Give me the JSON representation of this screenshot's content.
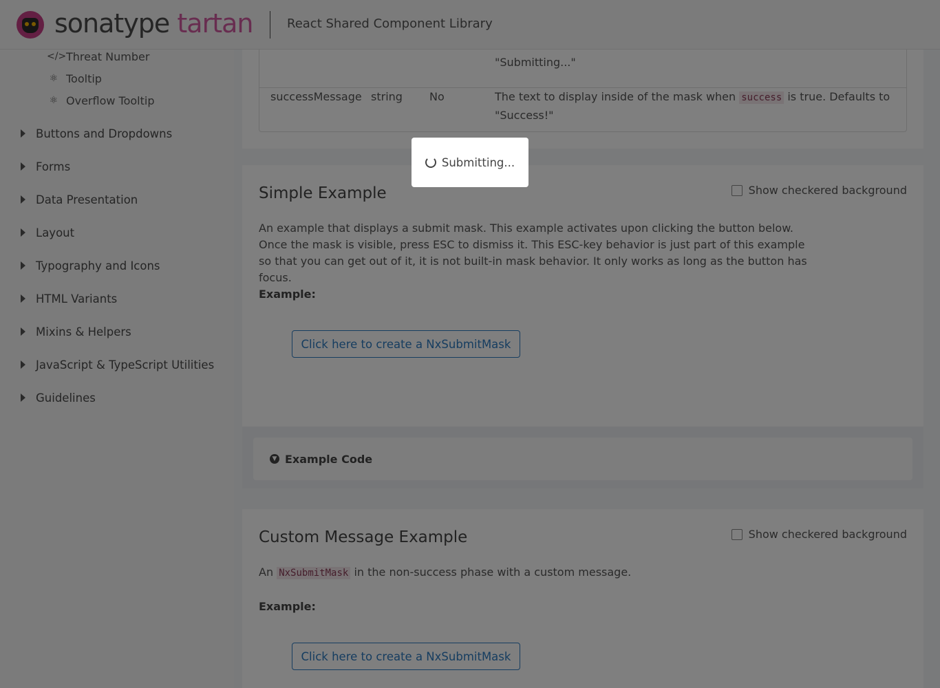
{
  "header": {
    "brand_primary": "sonatype",
    "brand_secondary": "tartan",
    "subtitle": "React Shared Component Library"
  },
  "sidebar": {
    "sub_items": [
      {
        "label": "Threat Number",
        "icon": "code-icon"
      },
      {
        "label": "Tooltip",
        "icon": "react-icon"
      },
      {
        "label": "Overflow Tooltip",
        "icon": "react-icon"
      }
    ],
    "sections": [
      "Buttons and Dropdowns",
      "Forms",
      "Data Presentation",
      "Layout",
      "Typography and Icons",
      "HTML Variants",
      "Mixins & Helpers",
      "JavaScript & TypeScript Utilities",
      "Guidelines"
    ]
  },
  "props_table": {
    "partial_row": {
      "desc_tail": "\"Submitting...\""
    },
    "rows": [
      {
        "name": "successMessage",
        "type": "string",
        "required": "No",
        "desc_before": "The text to display inside of the mask when",
        "desc_code": "success",
        "desc_after": "is true. Defaults to",
        "desc_line2": "\"Success!\""
      }
    ]
  },
  "simple_example": {
    "title": "Simple Example",
    "checkered_label": "Show checkered background",
    "description": "An example that displays a submit mask. This example activates upon clicking the button below. Once the mask is visible, press ESC to dismiss it. This ESC-key behavior is just part of this example so that you can get out of it, it is not built-in mask behavior. It only works as long as the button has focus.",
    "example_label": "Example:",
    "button_label": "Click here to create a NxSubmitMask",
    "code_toggle_label": "Example Code"
  },
  "custom_example": {
    "title": "Custom Message Example",
    "checkered_label": "Show checkered background",
    "desc_before": "An",
    "desc_code": "NxSubmitMask",
    "desc_after": "in the non-success phase with a custom message.",
    "example_label": "Example:",
    "button_label": "Click here to create a NxSubmitMask"
  },
  "submit_mask": {
    "message": "Submitting..."
  },
  "colors": {
    "brand_pink": "#d15aa0",
    "link_blue": "#2d7ac0",
    "overlay": "rgba(0,0,0,0.5)"
  }
}
